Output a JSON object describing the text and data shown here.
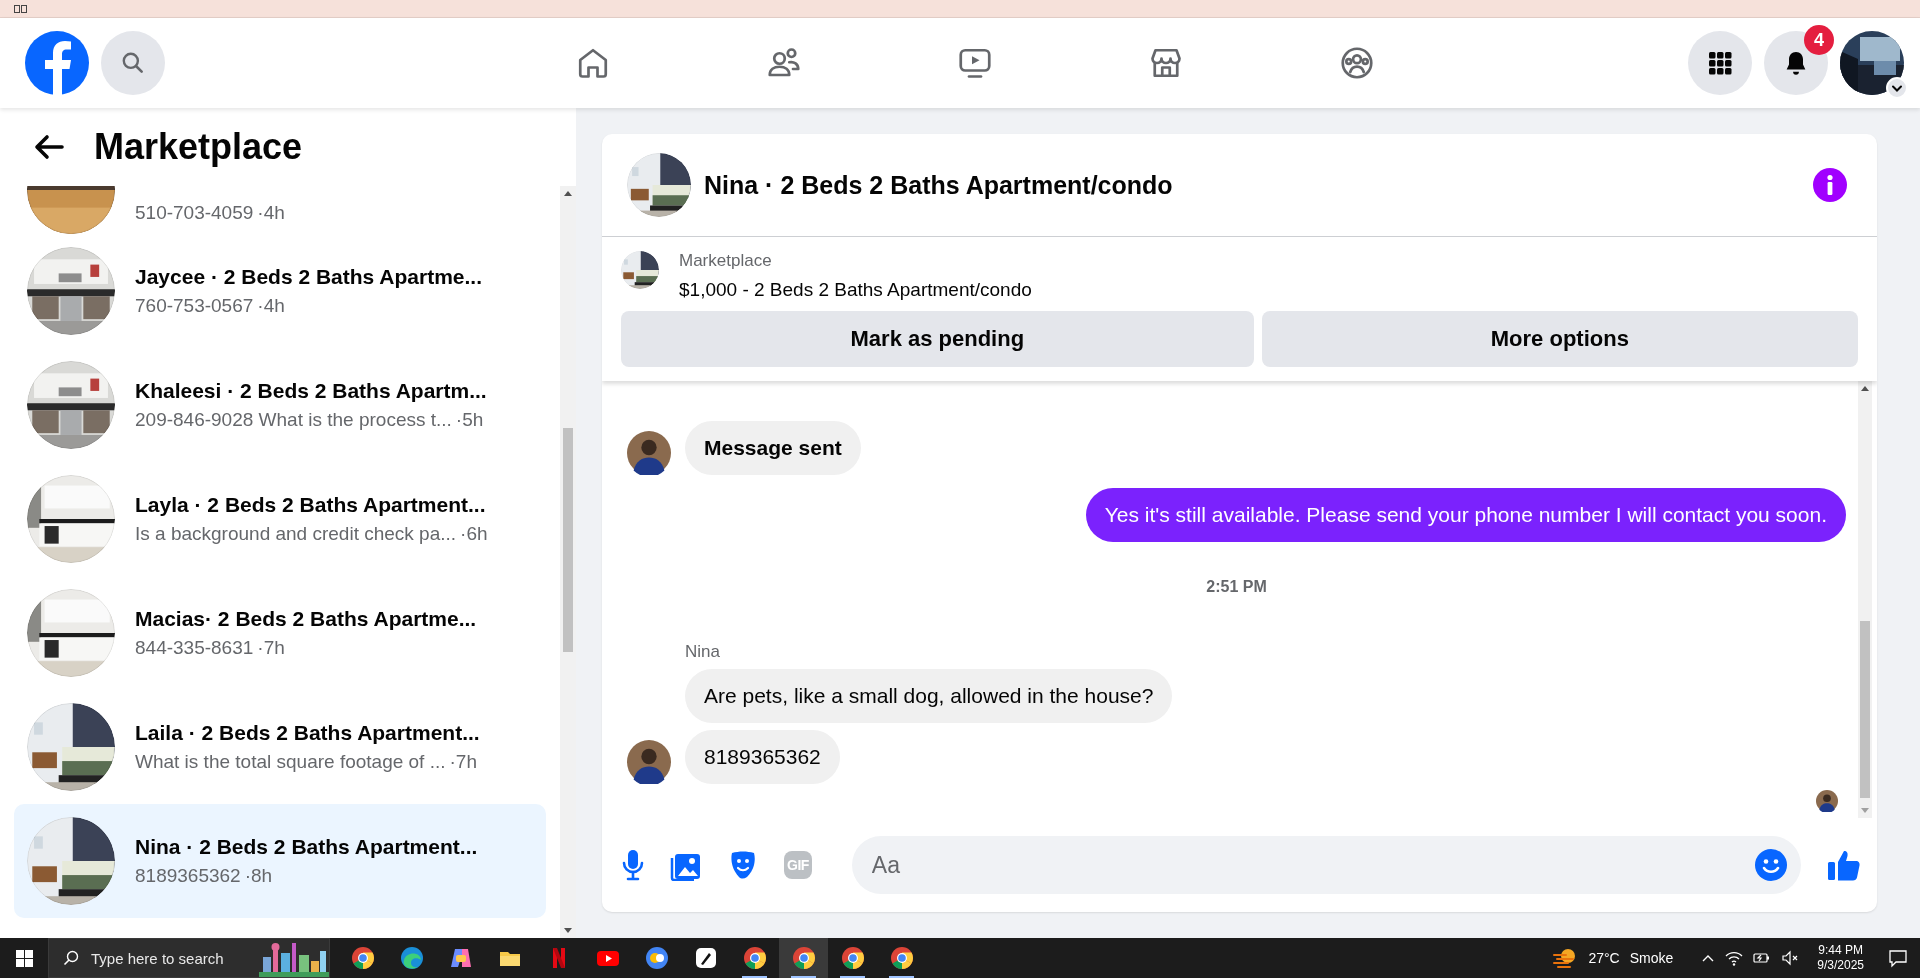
{
  "topbar": {
    "notification_count": "4"
  },
  "sidebar": {
    "title": "Marketplace",
    "conversations": [
      {
        "preview": "510-703-4059",
        "time": "·4h",
        "selected": false
      },
      {
        "title": "Jaycee · 2 Beds 2 Baths Apartme...",
        "preview": "760-753-0567",
        "time": "·4h",
        "selected": false
      },
      {
        "title": "Khaleesi · 2 Beds 2 Baths Apartm...",
        "preview": "209-846-9028 What is the process t...",
        "time": "·5h",
        "selected": false
      },
      {
        "title": "Layla · 2 Beds 2 Baths Apartment...",
        "preview": "Is a background and credit check pa...",
        "time": "·6h",
        "selected": false
      },
      {
        "title": "Macias· 2 Beds 2 Baths Apartme...",
        "preview": "844-335-8631",
        "time": "·7h",
        "selected": false
      },
      {
        "title": "Laila · 2 Beds 2 Baths Apartment...",
        "preview": "What is the total square footage of ...",
        "time": "·7h",
        "selected": false
      },
      {
        "title": "Nina · 2 Beds 2 Baths Apartment...",
        "preview": "8189365362",
        "time": "·8h",
        "selected": true
      }
    ]
  },
  "chat": {
    "title": "Nina · 2 Beds 2 Baths Apartment/condo",
    "listing": {
      "label": "Marketplace",
      "title": "$1,000 - 2 Beds 2 Baths Apartment/condo"
    },
    "buttons": [
      "Mark as pending",
      "More options"
    ],
    "messages": [
      {
        "kind": "incoming",
        "text": "Message sent",
        "bold": true,
        "avatar": true
      },
      {
        "kind": "outgoing",
        "text": "Yes it's still available. Please send your phone number I will contact you soon."
      },
      {
        "kind": "timestamp",
        "text": "2:51 PM"
      },
      {
        "kind": "sender",
        "text": "Nina"
      },
      {
        "kind": "incoming",
        "text": "Are pets, like a small dog, allowed in the house?",
        "bold": false,
        "avatar": false
      },
      {
        "kind": "incoming",
        "text": "8189365362",
        "bold": false,
        "avatar": true
      },
      {
        "kind": "seen"
      }
    ],
    "composer": {
      "placeholder": "Aa",
      "gif_label": "GIF"
    }
  },
  "taskbar": {
    "search_placeholder": "Type here to search",
    "apps": [
      {
        "kind": "chrome",
        "running": false,
        "selected": false
      },
      {
        "kind": "edge",
        "running": false,
        "selected": false
      },
      {
        "kind": "copilot",
        "running": false,
        "selected": false
      },
      {
        "kind": "folder",
        "running": false,
        "selected": false
      },
      {
        "kind": "netflix",
        "running": false,
        "selected": false
      },
      {
        "kind": "youtube",
        "running": false,
        "selected": false
      },
      {
        "kind": "meet",
        "running": false,
        "selected": false
      },
      {
        "kind": "pen",
        "running": false,
        "selected": false
      },
      {
        "kind": "chrome",
        "running": true,
        "selected": false
      },
      {
        "kind": "chrome",
        "running": true,
        "selected": true
      },
      {
        "kind": "chrome",
        "running": true,
        "selected": false
      },
      {
        "kind": "chrome",
        "running": true,
        "selected": false
      }
    ],
    "weather": {
      "temp": "27°C",
      "condition": "Smoke"
    },
    "clock": {
      "time": "9:44 PM",
      "date": "9/3/2025"
    }
  }
}
